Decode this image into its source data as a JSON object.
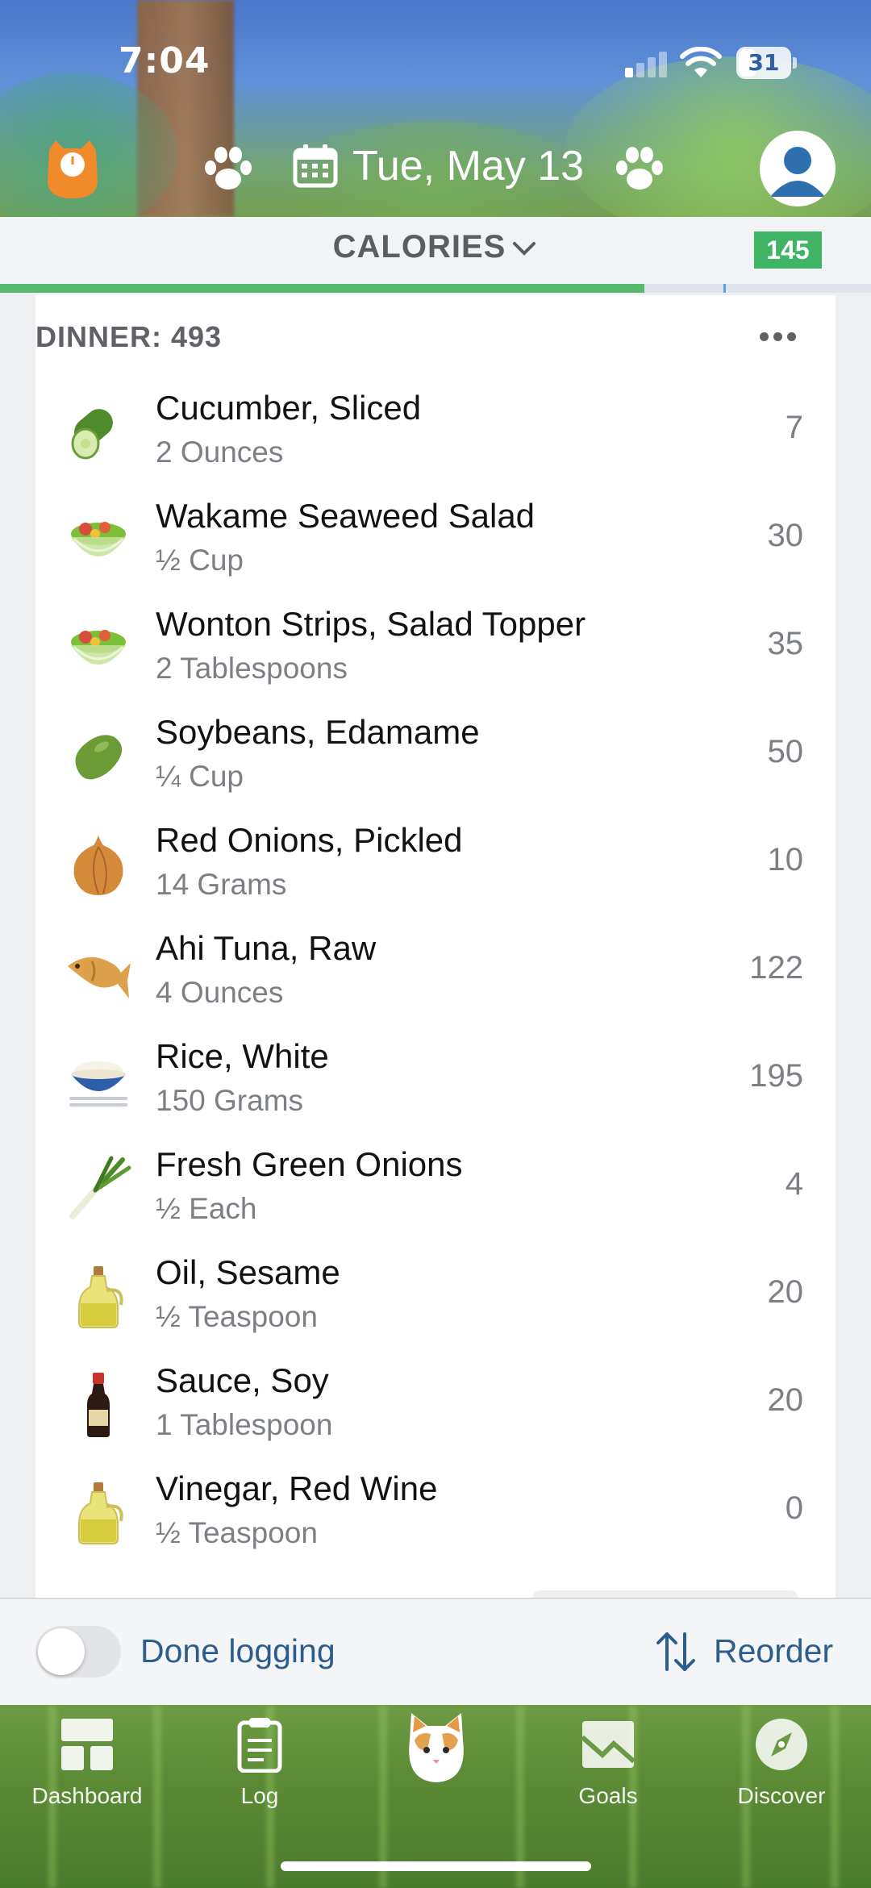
{
  "status_bar": {
    "time": "7:04",
    "battery": "31"
  },
  "header": {
    "date": "Tue, May 13"
  },
  "calories": {
    "label": "CALORIES",
    "remaining": "145",
    "progress_fraction": 0.74
  },
  "meal": {
    "title": "DINNER: 493",
    "items": [
      {
        "name": "Cucumber, Sliced",
        "qty": "2 Ounces",
        "cal": "7",
        "icon": "cucumber-icon"
      },
      {
        "name": "Wakame Seaweed Salad",
        "qty": "½ Cup",
        "cal": "30",
        "icon": "salad-bowl-icon"
      },
      {
        "name": "Wonton Strips, Salad Topper",
        "qty": "2 Tablespoons",
        "cal": "35",
        "icon": "salad-bowl-icon"
      },
      {
        "name": "Soybeans, Edamame",
        "qty": "¼ Cup",
        "cal": "50",
        "icon": "bean-icon"
      },
      {
        "name": "Red Onions, Pickled",
        "qty": "14 Grams",
        "cal": "10",
        "icon": "onion-icon"
      },
      {
        "name": "Ahi Tuna, Raw",
        "qty": "4 Ounces",
        "cal": "122",
        "icon": "fish-icon"
      },
      {
        "name": "Rice, White",
        "qty": "150 Grams",
        "cal": "195",
        "icon": "rice-bowl-icon"
      },
      {
        "name": "Fresh Green Onions",
        "qty": "½ Each",
        "cal": "4",
        "icon": "green-onion-icon"
      },
      {
        "name": "Oil, Sesame",
        "qty": "½ Teaspoon",
        "cal": "20",
        "icon": "oil-bottle-icon"
      },
      {
        "name": "Sauce, Soy",
        "qty": "1 Tablespoon",
        "cal": "20",
        "icon": "soy-sauce-icon"
      },
      {
        "name": "Vinegar, Red Wine",
        "qty": "½ Teaspoon",
        "cal": "0",
        "icon": "oil-bottle-icon"
      }
    ]
  },
  "actions": {
    "done_logging": "Done logging",
    "done_logging_on": false,
    "reorder": "Reorder"
  },
  "tabs": [
    {
      "label": "Dashboard",
      "icon": "dashboard-icon"
    },
    {
      "label": "Log",
      "icon": "clipboard-icon"
    },
    {
      "label": "",
      "icon": "cat-face-icon"
    },
    {
      "label": "Goals",
      "icon": "goals-chart-icon"
    },
    {
      "label": "Discover",
      "icon": "compass-icon"
    }
  ]
}
